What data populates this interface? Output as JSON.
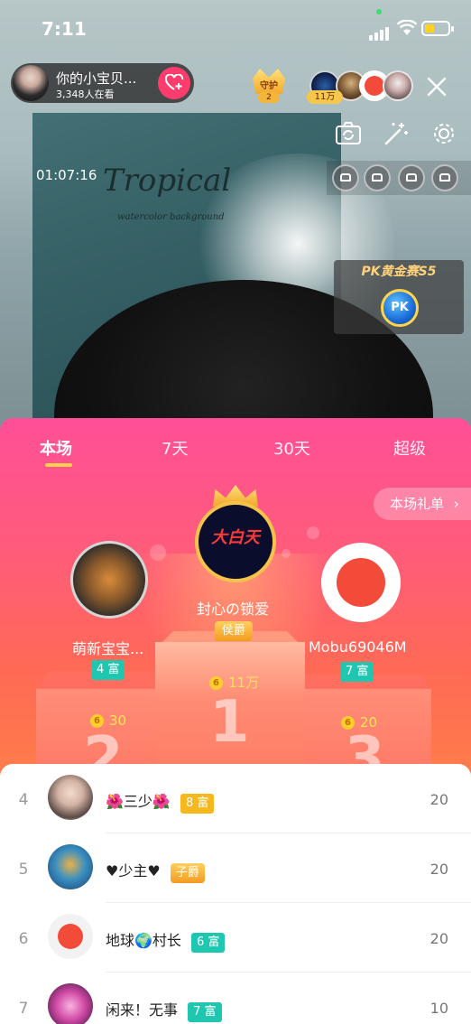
{
  "status": {
    "time": "7:11"
  },
  "host": {
    "name": "你的小宝贝...",
    "watching": "3,348人在看"
  },
  "guard": {
    "label": "守护",
    "count": "2"
  },
  "audience": {
    "badge": "11万"
  },
  "timer": "01:07:16",
  "poster": {
    "title": "Tropical",
    "subtitle": "watercolor background"
  },
  "pk": {
    "title": "PK黄金赛S5",
    "label": "PK"
  },
  "tabs": [
    "本场",
    "7天",
    "30天",
    "超级"
  ],
  "gift_list_button": "本场礼单",
  "podium": {
    "first": {
      "avatar_text": "大白天",
      "name": "封心の锁爱",
      "badge": "侯爵",
      "score": "11万",
      "rank": "1"
    },
    "second": {
      "name": "萌新宝宝...",
      "badge": "4 富",
      "score": "30",
      "rank": "2"
    },
    "third": {
      "name": "Mobu69046M",
      "badge": "7 富",
      "score": "20",
      "rank": "3"
    }
  },
  "coin_symbol": "6",
  "list": [
    {
      "rank": "4",
      "name": "🌺三少🌺",
      "badge": "8 富",
      "badge_color": "#f6b81d",
      "value": "20"
    },
    {
      "rank": "5",
      "name": "♥少主♥",
      "badge": "子爵",
      "badge_color": "#f39b21",
      "value": "20"
    },
    {
      "rank": "6",
      "name": "地球🌍村长",
      "badge": "6 富",
      "badge_color": "#1fc7b0",
      "value": "20"
    },
    {
      "rank": "7",
      "name": "闲来！无事",
      "badge": "7 富",
      "badge_color": "#1fc7b0",
      "value": "10"
    }
  ]
}
